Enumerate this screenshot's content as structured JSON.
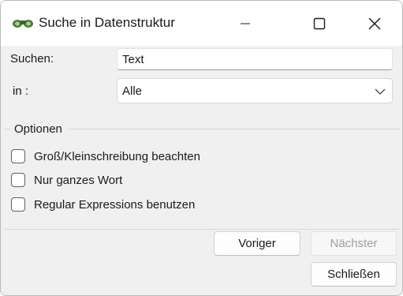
{
  "window": {
    "title": "Suche in Datenstruktur",
    "app_icon": "binoculars-icon"
  },
  "form": {
    "search_label": "Suchen:",
    "search_value": "Text",
    "in_label": "in :",
    "in_selected": "Alle"
  },
  "options": {
    "group_title": "Optionen",
    "items": [
      {
        "label": "Groß/Kleinschreibung beachten",
        "checked": false
      },
      {
        "label": "Nur ganzes Wort",
        "checked": false
      },
      {
        "label": "Regular Expressions benutzen",
        "checked": false
      }
    ]
  },
  "buttons": {
    "previous": "Voriger",
    "next": "Nächster",
    "close": "Schließen"
  },
  "colors": {
    "window_bg": "#f0f0f0",
    "disabled_text": "#a0a0a0"
  }
}
